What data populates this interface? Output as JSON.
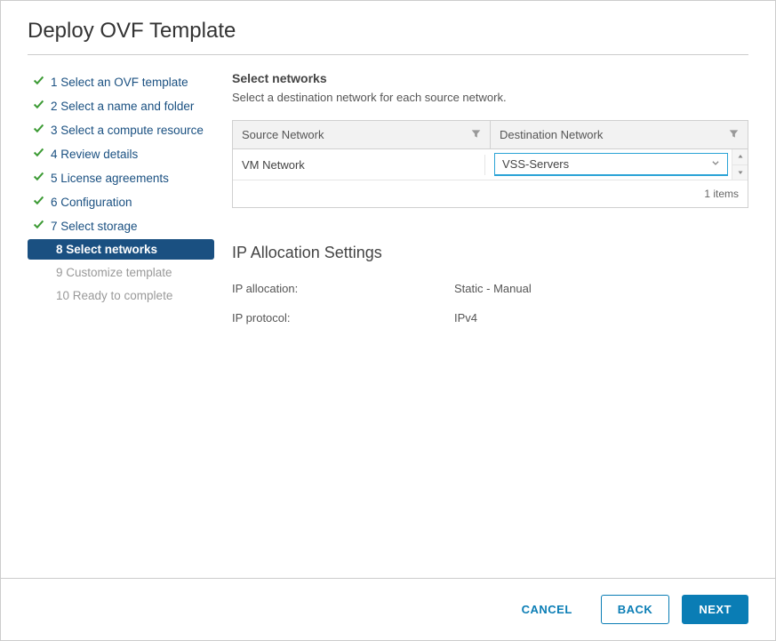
{
  "dialog": {
    "title": "Deploy OVF Template"
  },
  "sidebar": {
    "steps": [
      {
        "label": "1 Select an OVF template",
        "state": "completed"
      },
      {
        "label": "2 Select a name and folder",
        "state": "completed"
      },
      {
        "label": "3 Select a compute resource",
        "state": "completed"
      },
      {
        "label": "4 Review details",
        "state": "completed"
      },
      {
        "label": "5 License agreements",
        "state": "completed"
      },
      {
        "label": "6 Configuration",
        "state": "completed"
      },
      {
        "label": "7 Select storage",
        "state": "completed"
      },
      {
        "label": "8 Select networks",
        "state": "active"
      },
      {
        "label": "9 Customize template",
        "state": "upcoming"
      },
      {
        "label": "10 Ready to complete",
        "state": "upcoming"
      }
    ]
  },
  "main": {
    "section_title": "Select networks",
    "section_subtitle": "Select a destination network for each source network.",
    "table": {
      "col_source": "Source Network",
      "col_dest": "Destination Network",
      "rows": [
        {
          "source": "VM Network",
          "destination": "VSS-Servers"
        }
      ],
      "footer": "1 items"
    },
    "ip_settings": {
      "heading": "IP Allocation Settings",
      "alloc_label": "IP allocation:",
      "alloc_value": "Static - Manual",
      "proto_label": "IP protocol:",
      "proto_value": "IPv4"
    }
  },
  "footer": {
    "cancel": "CANCEL",
    "back": "BACK",
    "next": "NEXT"
  }
}
